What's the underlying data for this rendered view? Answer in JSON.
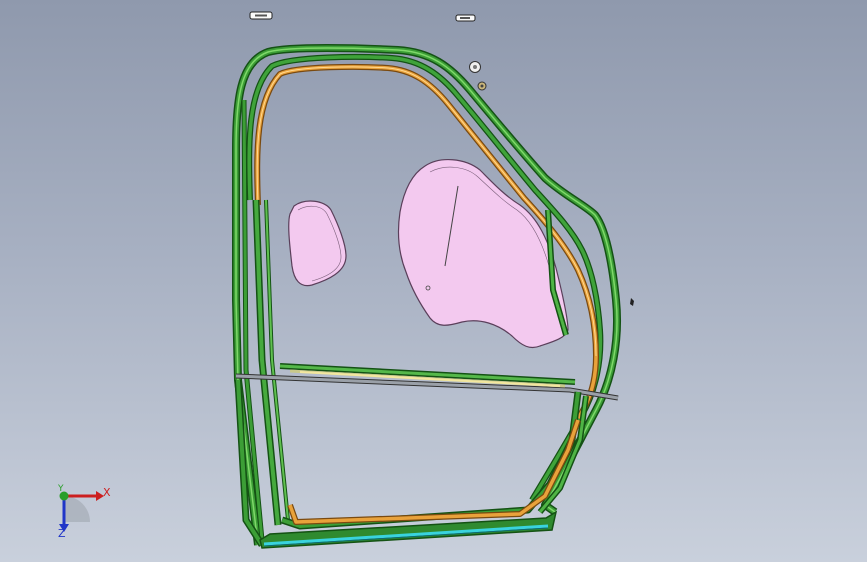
{
  "viewport": {
    "background_top": "#8f99ad",
    "background_bottom": "#c9d0dc"
  },
  "colors": {
    "frame_green": "#2f8a2f",
    "frame_green_light": "#6fcf5f",
    "frame_green_dark": "#145214",
    "seal_orange": "#e9a23b",
    "seal_yellow": "#f3e7a0",
    "sill_cyan": "#39d3dd",
    "panel_pink": "#f3c9ef",
    "panel_outline": "#5a3f5a"
  },
  "triad": {
    "x_label": "X",
    "y_label": "Z",
    "z_label": "Y",
    "x_color": "#cc1f1f",
    "y_color": "#2035c8",
    "z_color": "#2a9e2a",
    "icon": "coordinate-triad-icon"
  }
}
